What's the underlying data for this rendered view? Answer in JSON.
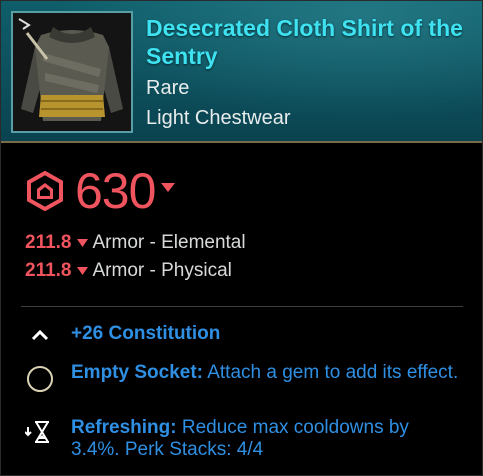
{
  "item": {
    "name": "Desecrated Cloth Shirt of the Sentry",
    "rarity": "Rare",
    "category": "Light Chestwear",
    "icon": "cloth-shirt-icon"
  },
  "gear_score": {
    "value": "630",
    "icon": "gear-score-icon",
    "trend": "down",
    "color": "#f0545e"
  },
  "stats": [
    {
      "value": "211.8",
      "trend": "down",
      "name": "Armor - Elemental"
    },
    {
      "value": "211.8",
      "trend": "down",
      "name": "Armor - Physical"
    }
  ],
  "perks": [
    {
      "icon": "attribute-chevron-icon",
      "title": "+26 Constitution",
      "desc": ""
    },
    {
      "icon": "empty-socket-icon",
      "title": "Empty Socket:",
      "desc": "Attach a gem to add its effect."
    },
    {
      "icon": "hourglass-icon",
      "title": "Refreshing:",
      "desc": "Reduce max cooldowns by 3.4%. Perk Stacks: 4/4"
    }
  ],
  "colors": {
    "title": "#3fe2f0",
    "header_bg": "#0d4f5c",
    "stat_value": "#f0545e",
    "perk_text": "#2f8fe3"
  }
}
